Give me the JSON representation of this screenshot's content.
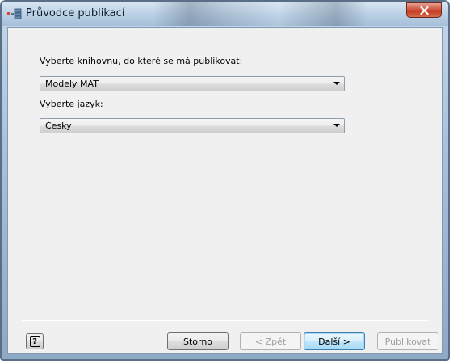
{
  "window": {
    "title": "Průvodce publikací",
    "close_icon": "close-icon"
  },
  "form": {
    "library_label": "Vyberte knihovnu, do které se má publikovat:",
    "library_value": "Modely MAT",
    "language_label": "Vyberte jazyk:",
    "language_value": "Česky"
  },
  "buttons": {
    "help_glyph": "?",
    "cancel": "Storno",
    "back": "< Zpět",
    "next": "Další >",
    "publish": "Publikovat"
  }
}
